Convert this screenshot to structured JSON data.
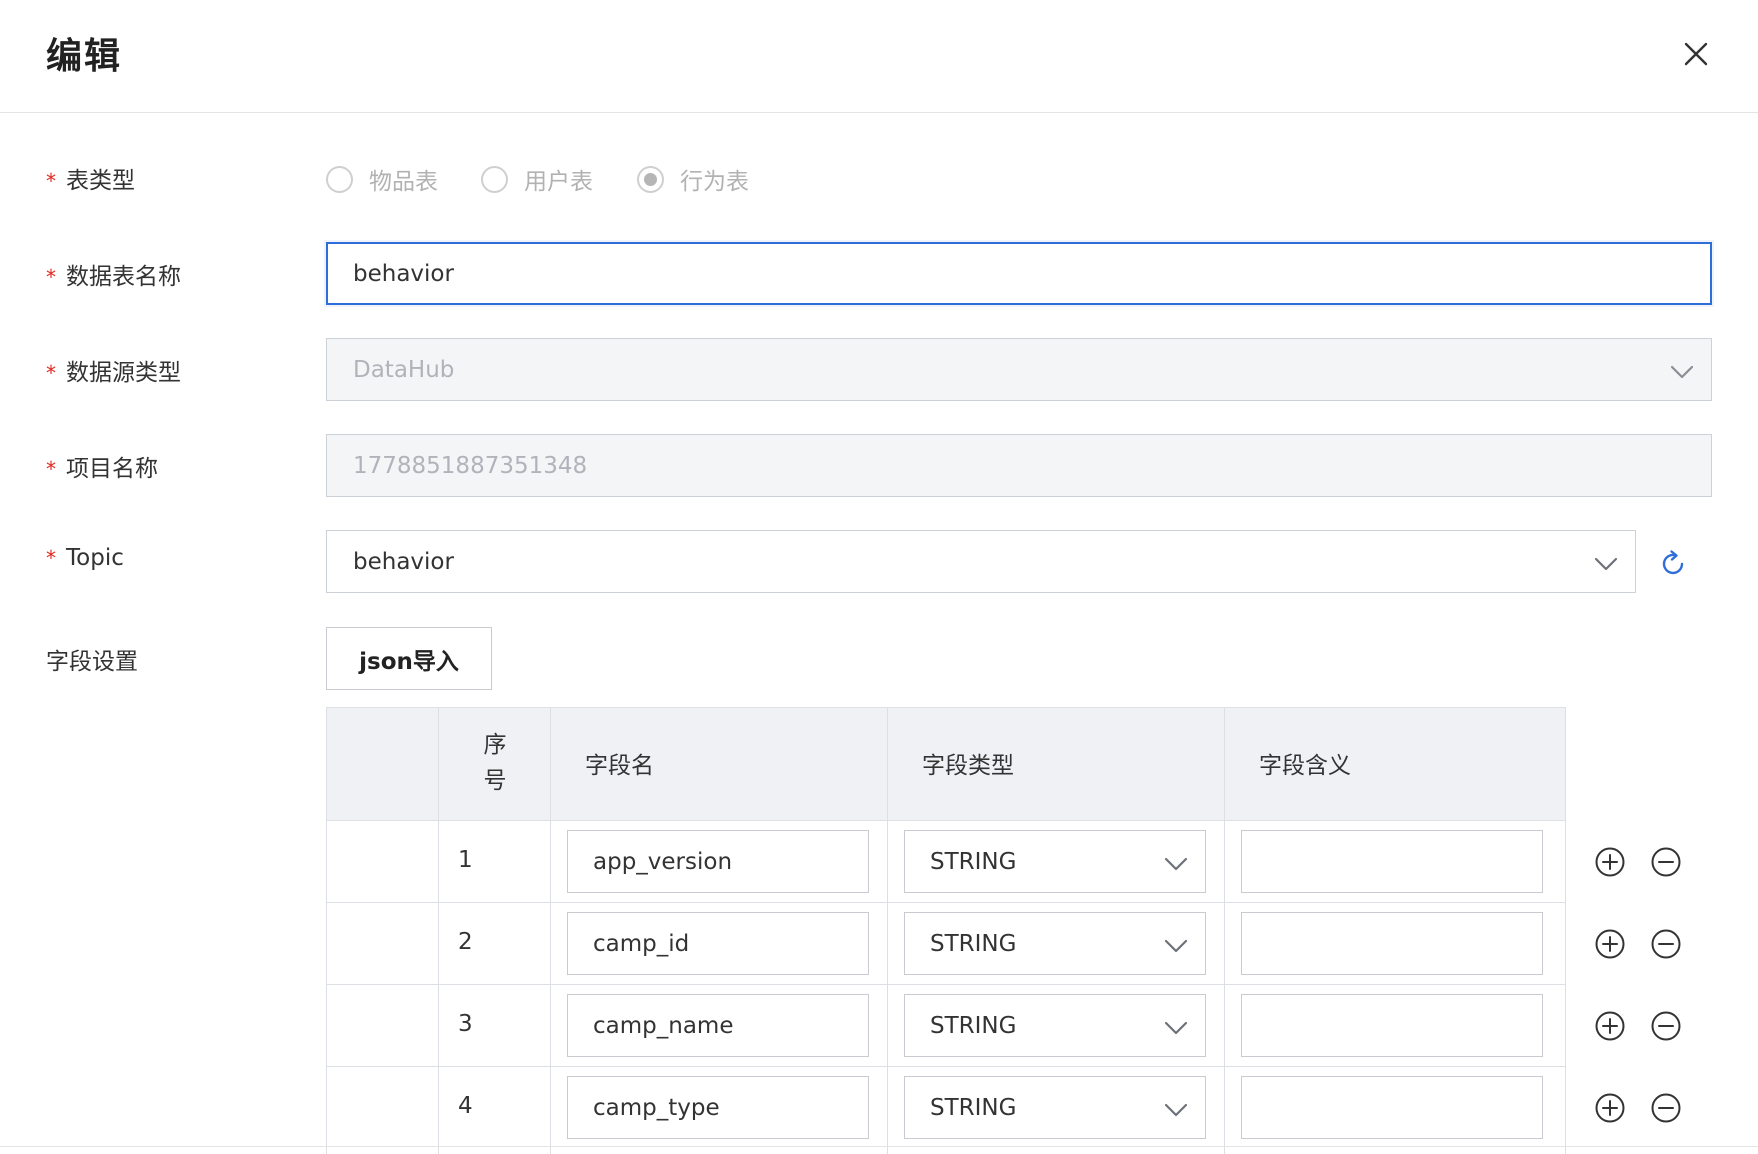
{
  "dialog": {
    "title": "编辑"
  },
  "form": {
    "table_type": {
      "label": "表类型",
      "options": [
        {
          "label": "物品表",
          "selected": false
        },
        {
          "label": "用户表",
          "selected": false
        },
        {
          "label": "行为表",
          "selected": true
        }
      ]
    },
    "table_name": {
      "label": "数据表名称",
      "value": "behavior"
    },
    "source_type": {
      "label": "数据源类型",
      "value": "DataHub"
    },
    "project_name": {
      "label": "项目名称",
      "value": "1778851887351348"
    },
    "topic": {
      "label": "Topic",
      "value": "behavior"
    },
    "field_settings": {
      "label": "字段设置",
      "import_button": "json导入"
    }
  },
  "table": {
    "headers": {
      "index": "序\n号",
      "name": "字段名",
      "type": "字段类型",
      "meaning": "字段含义"
    },
    "rows": [
      {
        "index": "1",
        "name": "app_version",
        "type": "STRING",
        "meaning": ""
      },
      {
        "index": "2",
        "name": "camp_id",
        "type": "STRING",
        "meaning": ""
      },
      {
        "index": "3",
        "name": "camp_name",
        "type": "STRING",
        "meaning": ""
      },
      {
        "index": "4",
        "name": "camp_type",
        "type": "STRING",
        "meaning": ""
      }
    ]
  },
  "icons": {
    "close": "close-icon",
    "dropdown": "chevron-down-icon",
    "refresh": "refresh-icon",
    "add": "plus-circle-icon",
    "remove": "minus-circle-icon"
  },
  "colors": {
    "required": "#e1251b",
    "accent": "#2f6ed8",
    "border": "#cdd2d8",
    "header_bg": "#eff1f4",
    "disabled_bg": "#f4f5f7"
  }
}
